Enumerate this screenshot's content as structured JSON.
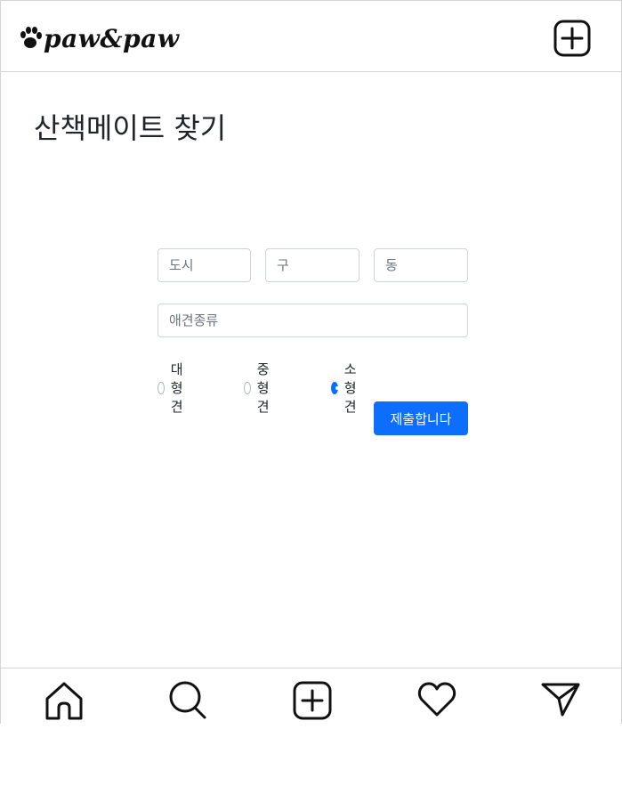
{
  "header": {
    "logo_text": "paw&paw",
    "add_icon": "plus-square-icon"
  },
  "page": {
    "title": "산책메이트 찾기"
  },
  "form": {
    "city_placeholder": "도시",
    "district_placeholder": "구",
    "dong_placeholder": "동",
    "breed_placeholder": "애견종류",
    "size_options": [
      {
        "label": "대형견",
        "checked": false
      },
      {
        "label": "중형견",
        "checked": false
      },
      {
        "label": "소형견",
        "checked": true
      }
    ],
    "submit_label": "제출합니다"
  },
  "bottom_nav": {
    "items": [
      "home-icon",
      "search-icon",
      "plus-square-icon",
      "heart-icon",
      "send-icon"
    ]
  },
  "colors": {
    "accent": "#0d6efd",
    "border": "#d4d4d4"
  }
}
